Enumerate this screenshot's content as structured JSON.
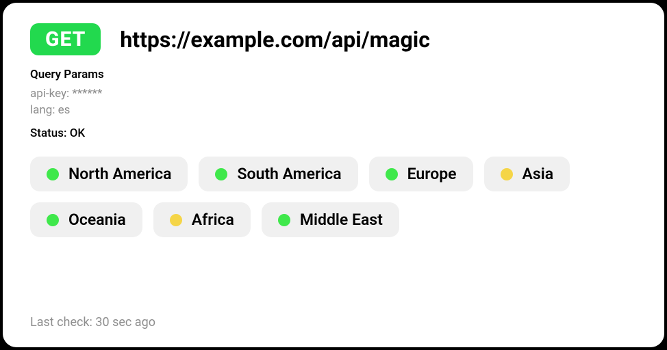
{
  "request": {
    "method": "GET",
    "url": "https://example.com/api/magic"
  },
  "query_params": {
    "label": "Query Params",
    "items": [
      {
        "key": "api-key",
        "value": "******"
      },
      {
        "key": "lang",
        "value": "es"
      }
    ]
  },
  "status": {
    "label": "Status",
    "value": "OK"
  },
  "regions": [
    {
      "name": "North America",
      "status": "green"
    },
    {
      "name": "South America",
      "status": "green"
    },
    {
      "name": "Europe",
      "status": "green"
    },
    {
      "name": "Asia",
      "status": "yellow"
    },
    {
      "name": "Oceania",
      "status": "green"
    },
    {
      "name": "Africa",
      "status": "yellow"
    },
    {
      "name": "Middle East",
      "status": "green"
    }
  ],
  "footer": {
    "last_check": "Last check: 30 sec ago"
  },
  "colors": {
    "green": "#3fe84b",
    "yellow": "#f5d547",
    "method_bg": "#22d94e"
  }
}
